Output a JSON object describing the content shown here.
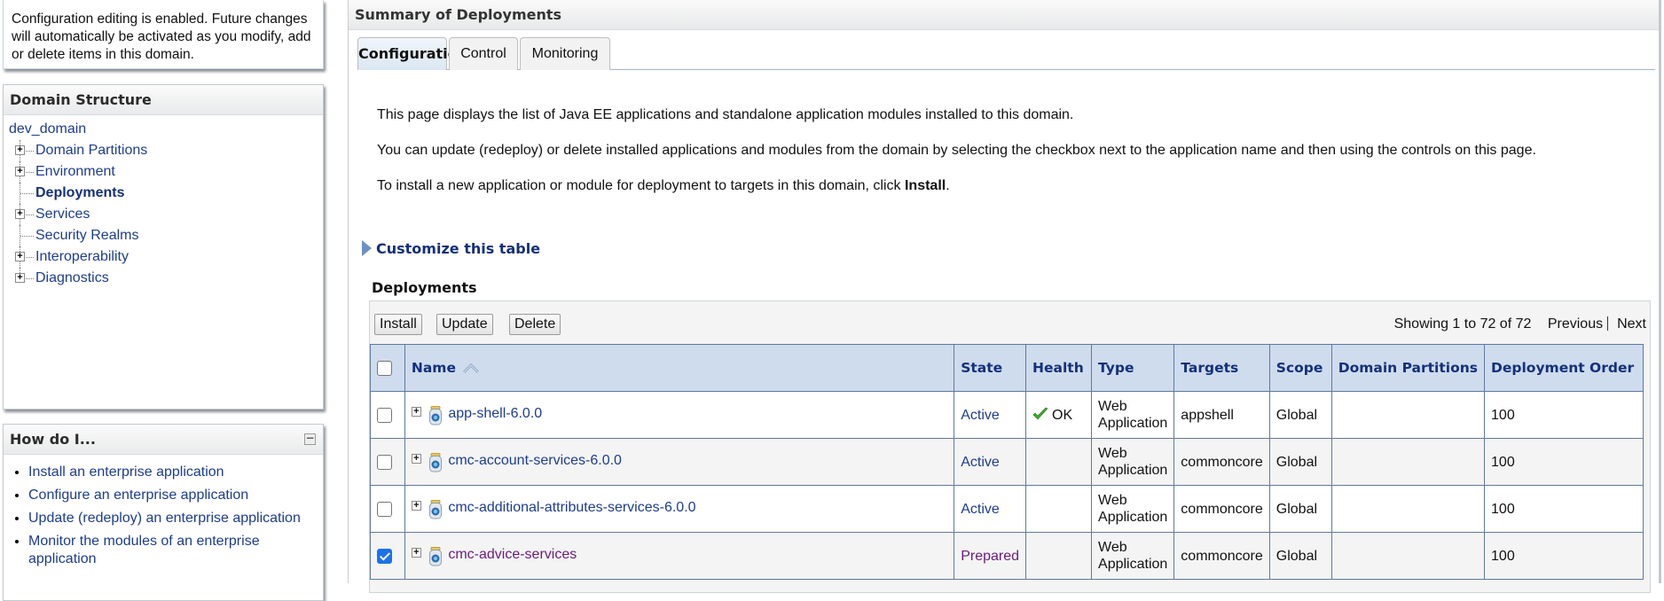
{
  "sidebar": {
    "message": "Configuration editing is enabled. Future changes will automatically be activated as you modify, add or delete items in this domain.",
    "domain_structure": {
      "title": "Domain Structure",
      "root": "dev_domain",
      "items": [
        {
          "label": "Domain Partitions",
          "expandable": true,
          "current": false
        },
        {
          "label": "Environment",
          "expandable": true,
          "current": false
        },
        {
          "label": "Deployments",
          "expandable": false,
          "current": true
        },
        {
          "label": "Services",
          "expandable": true,
          "current": false
        },
        {
          "label": "Security Realms",
          "expandable": false,
          "current": false
        },
        {
          "label": "Interoperability",
          "expandable": true,
          "current": false
        },
        {
          "label": "Diagnostics",
          "expandable": true,
          "current": false
        }
      ]
    },
    "how_do_i": {
      "title": "How do I...",
      "collapse_icon": "minus-square-icon",
      "links": [
        "Install an enterprise application",
        "Configure an enterprise application",
        "Update (redeploy) an enterprise application",
        "Monitor the modules of an enterprise application"
      ]
    }
  },
  "main": {
    "title": "Summary of Deployments",
    "tabs": [
      {
        "label": "Configuration",
        "active": true
      },
      {
        "label": "Control",
        "active": false
      },
      {
        "label": "Monitoring",
        "active": false
      }
    ],
    "intro": {
      "p1": "This page displays the list of Java EE applications and standalone application modules installed to this domain.",
      "p2": "You can update (redeploy) or delete installed applications and modules from the domain by selecting the checkbox next to the application name and then using the controls on this page.",
      "p3_prefix": "To install a new application or module for deployment to targets in this domain, click ",
      "p3_bold": "Install",
      "p3_suffix": "."
    },
    "customize_label": "Customize this table",
    "deployments_label": "Deployments",
    "toolbar": {
      "install": "Install",
      "update": "Update",
      "delete": "Delete",
      "showing": "Showing 1 to 72 of 72",
      "previous": "Previous",
      "next": "Next"
    },
    "table": {
      "columns": [
        "Name",
        "State",
        "Health",
        "Type",
        "Targets",
        "Scope",
        "Domain Partitions",
        "Deployment Order"
      ],
      "sort_column": "Name",
      "sort_direction": "ascending",
      "rows": [
        {
          "checked": false,
          "name": "app-shell-6.0.0",
          "state": "Active",
          "health": "OK",
          "type": "Web Application",
          "targets": "appshell",
          "scope": "Global",
          "domain_partitions": "",
          "deployment_order": "100",
          "visited": false
        },
        {
          "checked": false,
          "name": "cmc-account-services-6.0.0",
          "state": "Active",
          "health": "",
          "type": "Web Application",
          "targets": "commoncore",
          "scope": "Global",
          "domain_partitions": "",
          "deployment_order": "100",
          "visited": false
        },
        {
          "checked": false,
          "name": "cmc-additional-attributes-services-6.0.0",
          "state": "Active",
          "health": "",
          "type": "Web Application",
          "targets": "commoncore",
          "scope": "Global",
          "domain_partitions": "",
          "deployment_order": "100",
          "visited": false
        },
        {
          "checked": true,
          "name": "cmc-advice-services",
          "state": "Prepared",
          "health": "",
          "type": "Web Application",
          "targets": "commoncore",
          "scope": "Global",
          "domain_partitions": "",
          "deployment_order": "100",
          "visited": true
        }
      ]
    }
  },
  "colors": {
    "link": "#1d3c8f",
    "visited_link": "#6a1b7a",
    "table_header_bg": "#cfdcee",
    "health_ok": "#3cab2a",
    "checkbox_checked": "#1a73e8"
  }
}
